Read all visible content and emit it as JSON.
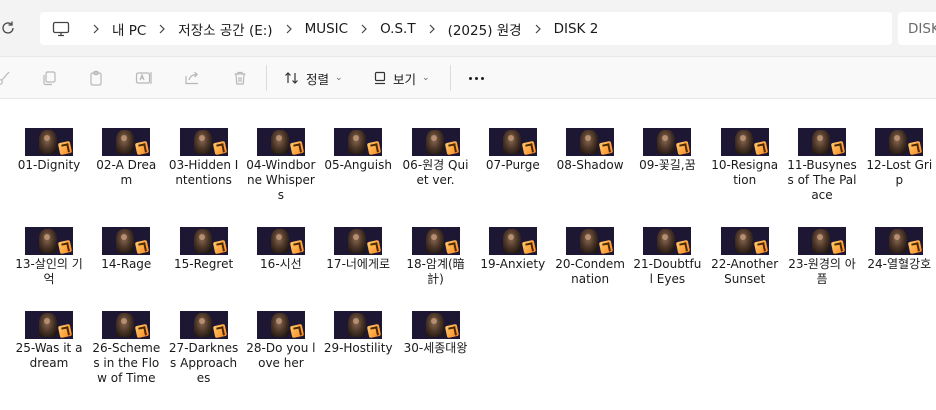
{
  "address": {
    "crumbs": [
      "내 PC",
      "저장소 공간 (E:)",
      "MUSIC",
      "O.S.T",
      "(2025) 원경",
      "DISK 2"
    ],
    "search_placeholder": "DISK"
  },
  "toolbar": {
    "sort_label": "정렬",
    "view_label": "보기"
  },
  "files": [
    "01-Dignity",
    "02-A Dream",
    "03-Hidden Intentions",
    "04-Windborne Whispers",
    "05-Anguish",
    "06-원경 Quiet ver.",
    "07-Purge",
    "08-Shadow",
    "09-꽃길,꿈",
    "10-Resignation",
    "11-Busyness of The Palace",
    "12-Lost Grip",
    "13-살인의 기억",
    "14-Rage",
    "15-Regret",
    "16-시선",
    "17-너에게로",
    "18-암계(暗計)",
    "19-Anxiety",
    "20-Condemnation",
    "21-Doubtful Eyes",
    "22-AnotherSunset",
    "23-원경의 아픔",
    "24-열혈강호",
    "25-Was it a dream",
    "26-Schemes in the Flow of Time",
    "27-Darkness Approaches",
    "28-Do you love her",
    "29-Hostility",
    "30-세종대왕"
  ],
  "icons": {
    "refresh": "refresh-icon",
    "pc": "computer-icon",
    "cut": "cut-icon",
    "copy": "copy-icon",
    "paste": "paste-icon",
    "rename": "rename-icon",
    "share": "share-icon",
    "delete": "trash-icon",
    "sort": "sort-icon",
    "view": "view-icon",
    "more": "more-icon",
    "file_badge": "audio-file-icon"
  }
}
